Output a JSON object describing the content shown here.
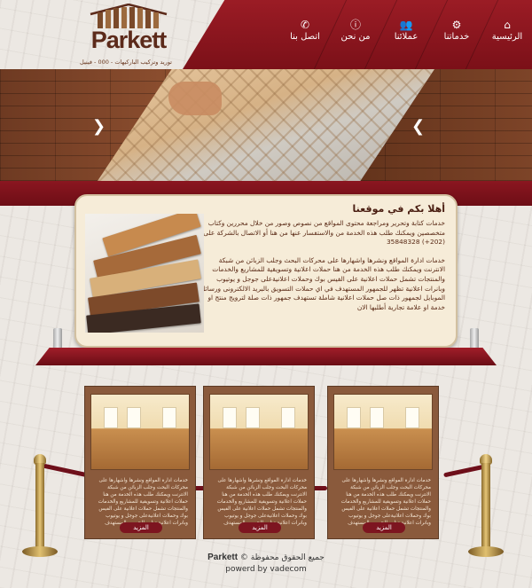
{
  "brand": {
    "logo_text": "Parkett",
    "tagline": "توريد وتركيب الباركيهات - 000 - فينيل"
  },
  "nav": {
    "items": [
      {
        "label": "الرئيسية",
        "icon": "home-icon"
      },
      {
        "label": "خدماتنا",
        "icon": "gears-icon"
      },
      {
        "label": "عملائنا",
        "icon": "users-icon"
      },
      {
        "label": "من نحن",
        "icon": "info-icon"
      },
      {
        "label": "اتصل بنا",
        "icon": "phone-icon"
      }
    ]
  },
  "welcome": {
    "title": "أهلا بكم في موقعنا",
    "paragraphs": [
      "خدمات كتابة وتحرير ومراجعة محتوى المواقع من نصوص وصور من خلال محررين وكتاب متخصصين ويمكنك طلب هذه الخدمة من والاستفسار عنها من هنا أو الاتصال بالشركة على (202+) 35848328",
      "خدمات ادارة المواقع ونشرها واشهارها على محركات البحث وجلب الزبائن من شبكة الانترنت ويمكنك طلب هذه الخدمة من هنا حملات اعلانية وتسويقية للمشاريع والخدمات والمنتجات تشمل حملات اعلانية على الفيس بوك وحملات اعلانيةعلى جوجل و يوتيوب وبانرات اعلانية تظهر للجمهور المستهدف في اي حملات التسويق بالبريد الالكترونى ورسائل الموبايل لجمهور ذات صل حملات اعلانية شاملة تستهدف جمهور ذات صلة لترويج منتج او خدمة او علامة تجارية أطلبها الان"
    ]
  },
  "cards": [
    {
      "text": "خدمات ادارة المواقع ونشرها واشهارها على محركات البحث وجلب الزبائن من شبكة الانترنت ويمكنك طلب هذه الخدمة من هنا حملات اعلانية وتسويقية للمشاريع والخدمات والمنتجات تشمل حملات اعلانية على الفيس بوك وحملات اعلانيةعلى جوجل و يوتيوب وبانرات اعلانية تظهر للجمهور المستهدف",
      "button": "المزيد"
    },
    {
      "text": "خدمات ادارة المواقع ونشرها واشهارها على محركات البحث وجلب الزبائن من شبكة الانترنت ويمكنك طلب هذه الخدمة من هنا حملات اعلانية وتسويقية للمشاريع والخدمات والمنتجات تشمل حملات اعلانية على الفيس بوك وحملات اعلانيةعلى جوجل و يوتيوب وبانرات اعلانية تظهر للجمهور المستهدف",
      "button": "المزيد"
    },
    {
      "text": "خدمات ادارة المواقع ونشرها واشهارها على محركات البحث وجلب الزبائن من شبكة الانترنت ويمكنك طلب هذه الخدمة من هنا حملات اعلانية وتسويقية للمشاريع والخدمات والمنتجات تشمل حملات اعلانية على الفيس بوك وحملات اعلانيةعلى جوجل و يوتيوب وبانرات اعلانية تظهر للجمهور المستهدف",
      "button": "المزيد"
    }
  ],
  "footer": {
    "rights": "جميع الحقوق محفوظة",
    "brand": "Parkett",
    "copyright_symbol": "©",
    "powered": "powerd by vadecom"
  },
  "colors": {
    "nav_red": "#8b1620",
    "panel_cream": "#f6ecd8",
    "card_brown": "#8a5a3c"
  }
}
